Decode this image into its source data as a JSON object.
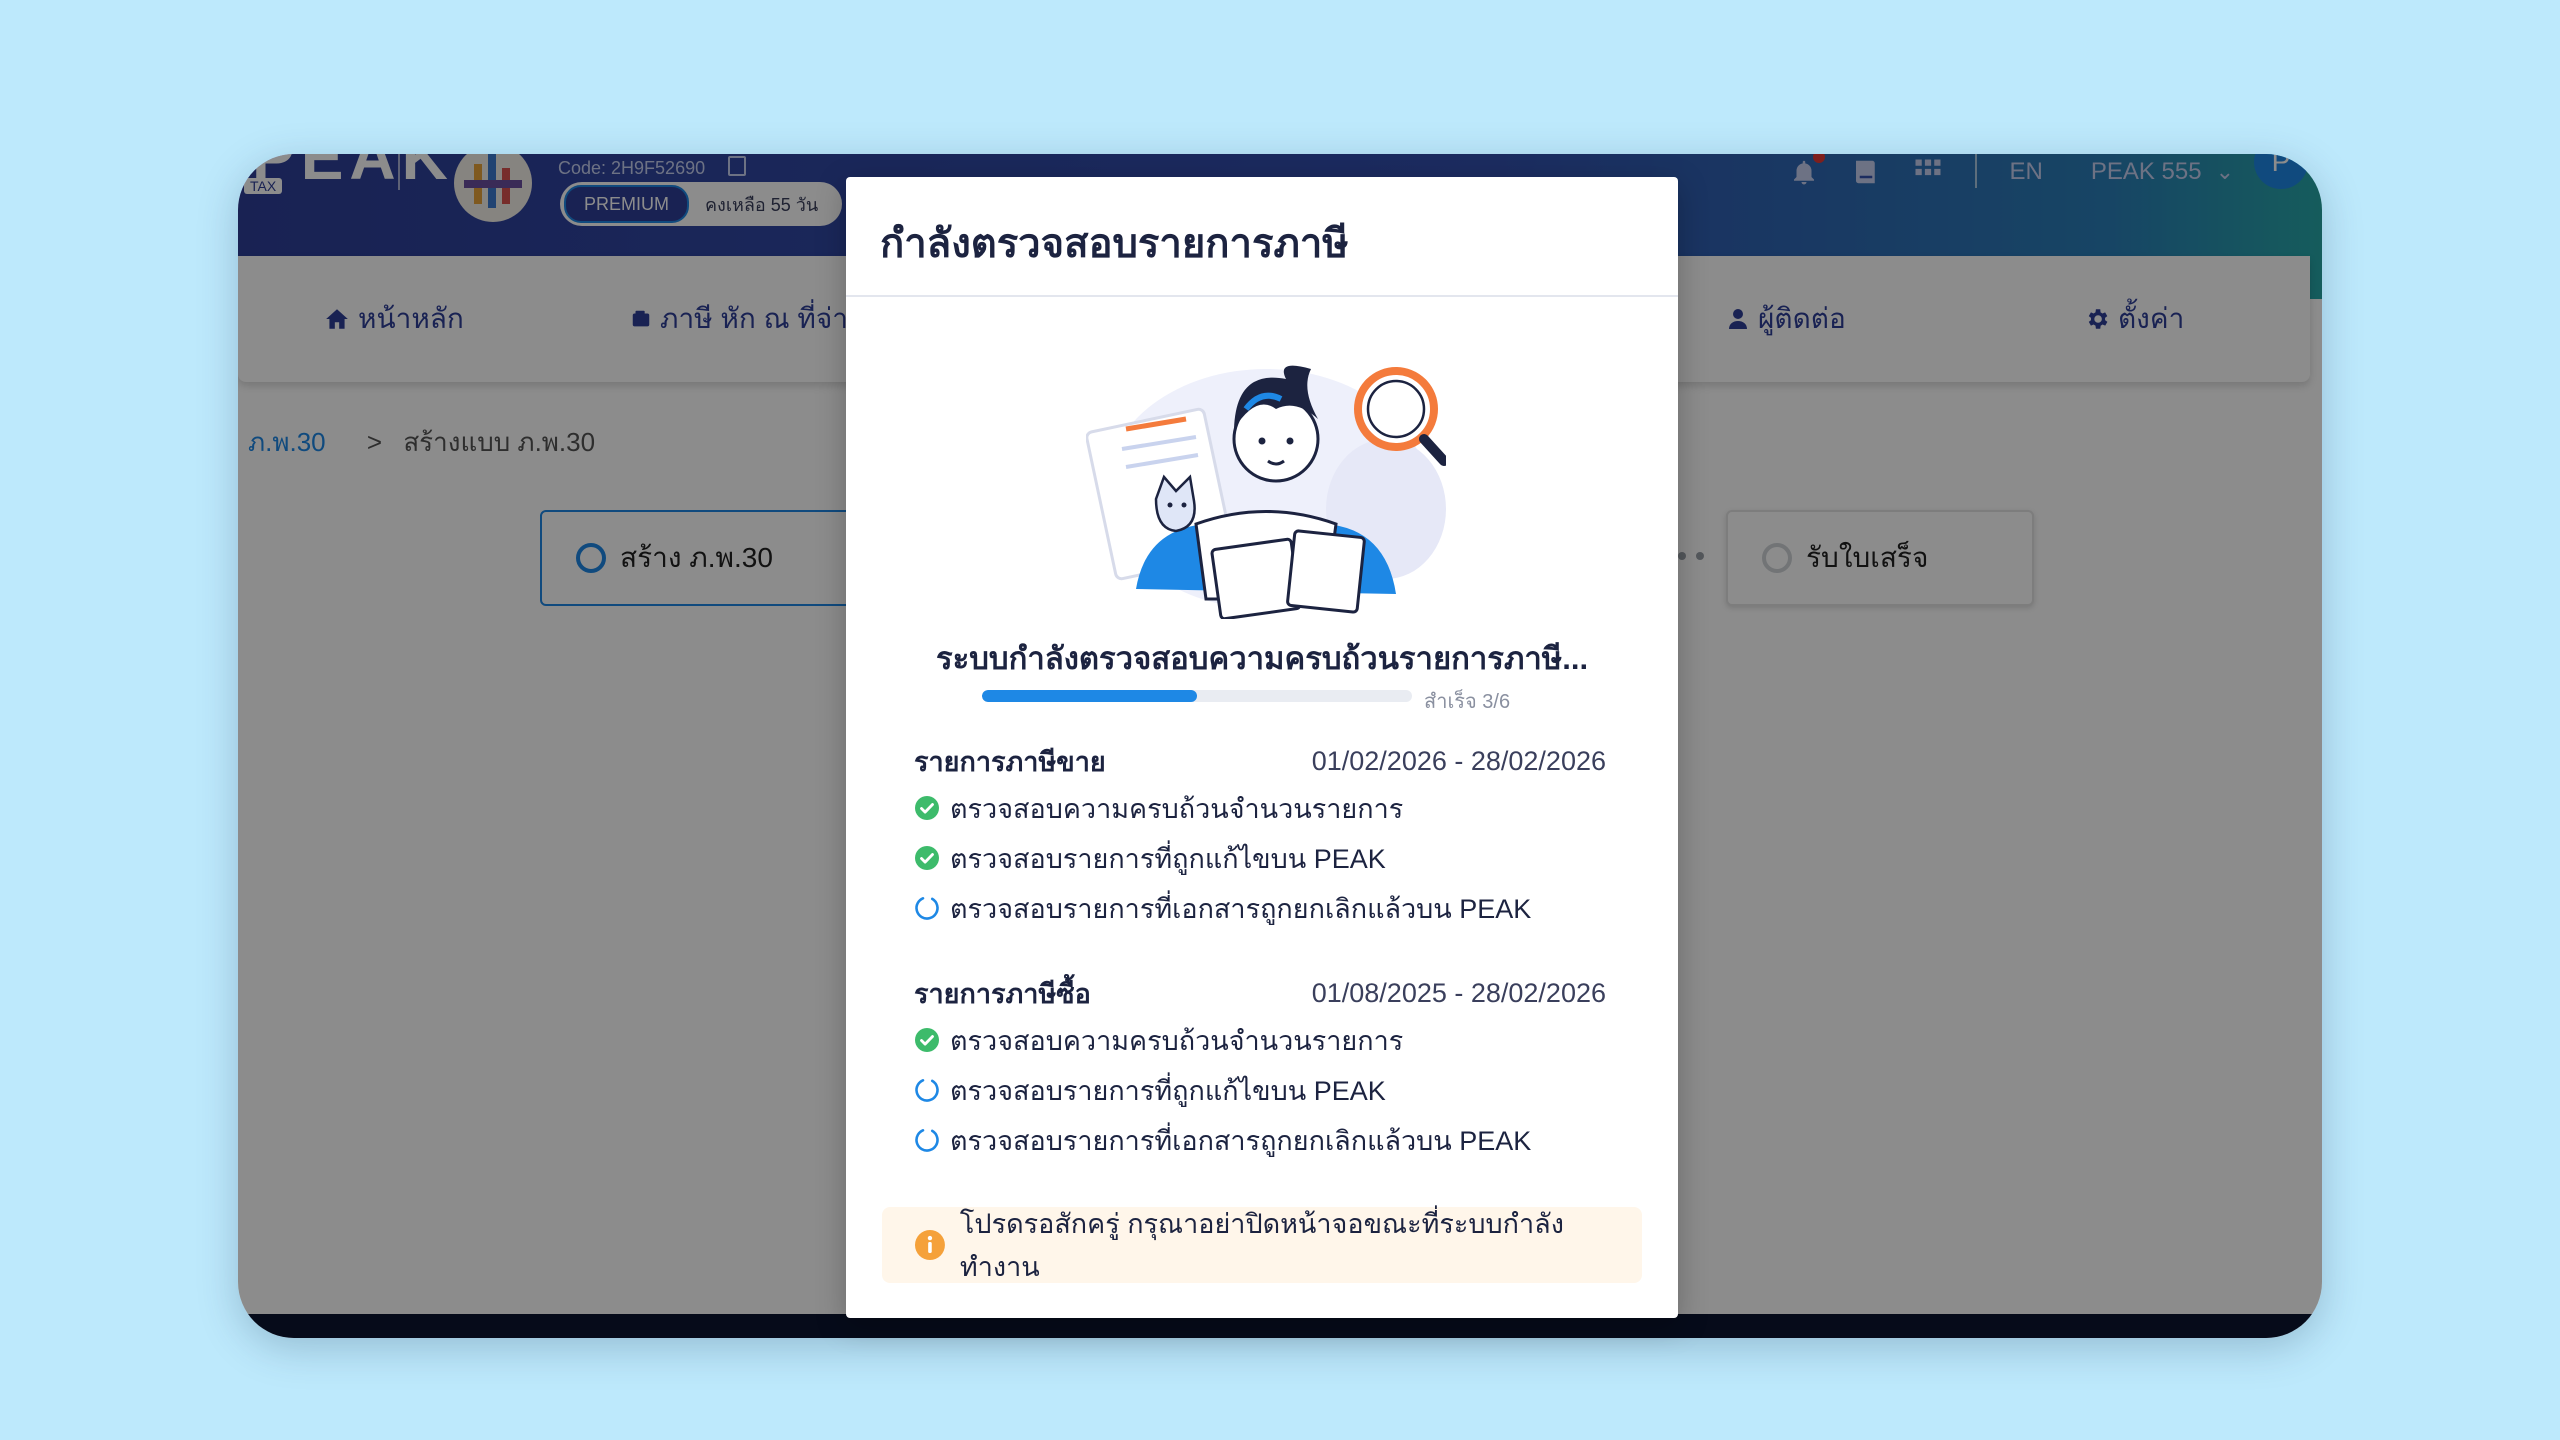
{
  "header": {
    "logo_text": "PEAK",
    "logo_badge": "TAX",
    "company_code": "Code: 2H9F52690",
    "plan_badge": "PREMIUM",
    "plan_remaining": "คงเหลือ 55 วัน",
    "language": "EN",
    "user_name": "PEAK 555",
    "avatar_initial": "P"
  },
  "nav": {
    "items": [
      {
        "label": "หน้าหลัก",
        "icon": "home-icon"
      },
      {
        "label": "ภาษี หัก ณ ที่จ่าย",
        "icon": "wallet-icon"
      },
      {
        "label": "ผู้ติดต่อ",
        "icon": "user-icon"
      },
      {
        "label": "ตั้งค่า",
        "icon": "gear-icon"
      }
    ]
  },
  "breadcrumb": {
    "parent": "ภ.พ.30",
    "separator": ">",
    "current": "สร้างแบบ ภ.พ.30"
  },
  "steps": [
    {
      "label": "สร้าง ภ.พ.30",
      "state": "active"
    },
    {
      "label": "รับใบเสร็จ",
      "state": "inactive"
    }
  ],
  "modal": {
    "title": "กำลังตรวจสอบรายการภาษี",
    "status_text": "ระบบกำลังตรวจสอบความครบถ้วนรายการภาษี...",
    "progress": {
      "label": "สำเร็จ 3/6",
      "completed": 3,
      "total": 6
    },
    "sections": [
      {
        "title": "รายการภาษีขาย",
        "date_range": "01/02/2026 - 28/02/2026",
        "checks": [
          {
            "label": "ตรวจสอบความครบถ้วนจำนวนรายการ",
            "status": "done"
          },
          {
            "label": "ตรวจสอบรายการที่ถูกแก้ไขบน PEAK",
            "status": "done"
          },
          {
            "label": "ตรวจสอบรายการที่เอกสารถูกยกเลิกแล้วบน PEAK",
            "status": "loading"
          }
        ]
      },
      {
        "title": "รายการภาษีซื้อ",
        "date_range": "01/08/2025 - 28/02/2026",
        "checks": [
          {
            "label": "ตรวจสอบความครบถ้วนจำนวนรายการ",
            "status": "done"
          },
          {
            "label": "ตรวจสอบรายการที่ถูกแก้ไขบน PEAK",
            "status": "loading"
          },
          {
            "label": "ตรวจสอบรายการที่เอกสารถูกยกเลิกแล้วบน PEAK",
            "status": "loading"
          }
        ]
      }
    ],
    "note": "โปรดรอสักครู่ กรุณาอย่าปิดหน้าจอขณะที่ระบบกำลังทำงาน"
  },
  "colors": {
    "background": "#bde9fc",
    "brand": "#2e3f98",
    "accent": "#1e88e5",
    "success": "#3dbb6b",
    "warning": "#f5a13a"
  }
}
